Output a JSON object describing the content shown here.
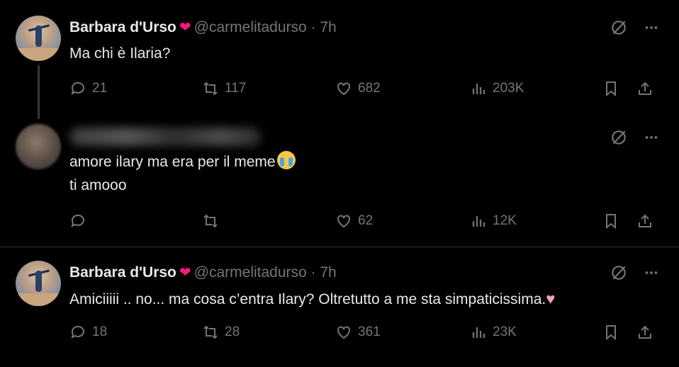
{
  "tweets": [
    {
      "name": "Barbara d'Urso",
      "heart": "❤",
      "handle": "@carmelitadurso · 7h",
      "text": "Ma chi è Ilaria?",
      "replies": "21",
      "retweets": "117",
      "likes": "682",
      "views": "203K"
    },
    {
      "text_line1": "amore ilary ma era per il meme",
      "text_line2": "ti amooo",
      "replies": "",
      "retweets": "",
      "likes": "62",
      "views": "12K"
    },
    {
      "name": "Barbara d'Urso",
      "heart": "❤",
      "handle": "@carmelitadurso · 7h",
      "text": "Amiciiiii .. no... ma cosa c’entra Ilary? Oltretutto a me sta simpaticissima.",
      "text_emoji": "♥",
      "replies": "18",
      "retweets": "28",
      "likes": "361",
      "views": "23K"
    }
  ],
  "icons": {
    "grok": "grok-icon",
    "more": "more-icon",
    "reply": "reply-icon",
    "retweet": "retweet-icon",
    "like": "like-icon",
    "views": "views-icon",
    "bookmark": "bookmark-icon",
    "share": "share-icon"
  },
  "colors": {
    "background": "#000000",
    "text": "#e7e9ea",
    "secondary": "#71767b",
    "verified_heart": "#f91880"
  }
}
